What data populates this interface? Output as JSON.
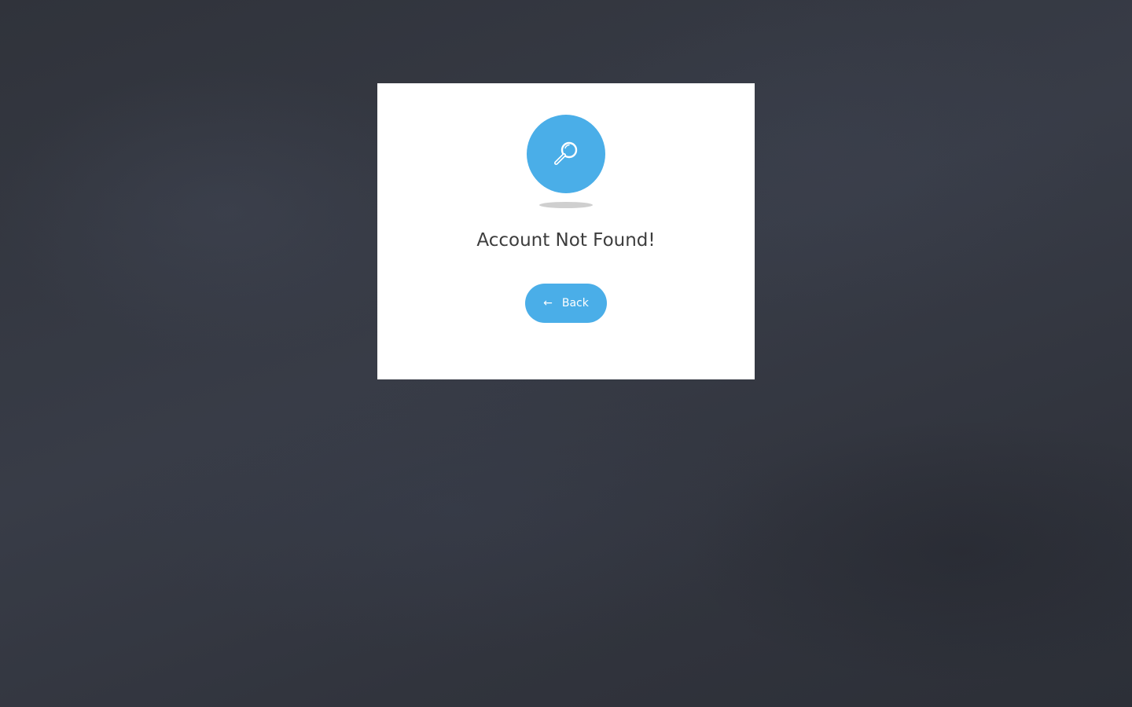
{
  "page": {
    "background_color": "#33363f"
  },
  "dialog": {
    "icon": "magnifying-glass-icon",
    "accent_color": "#4aaee8",
    "title": "Account Not Found!",
    "back_button": {
      "icon": "arrow-left-icon",
      "arrow_glyph": "←",
      "label": "Back"
    }
  }
}
